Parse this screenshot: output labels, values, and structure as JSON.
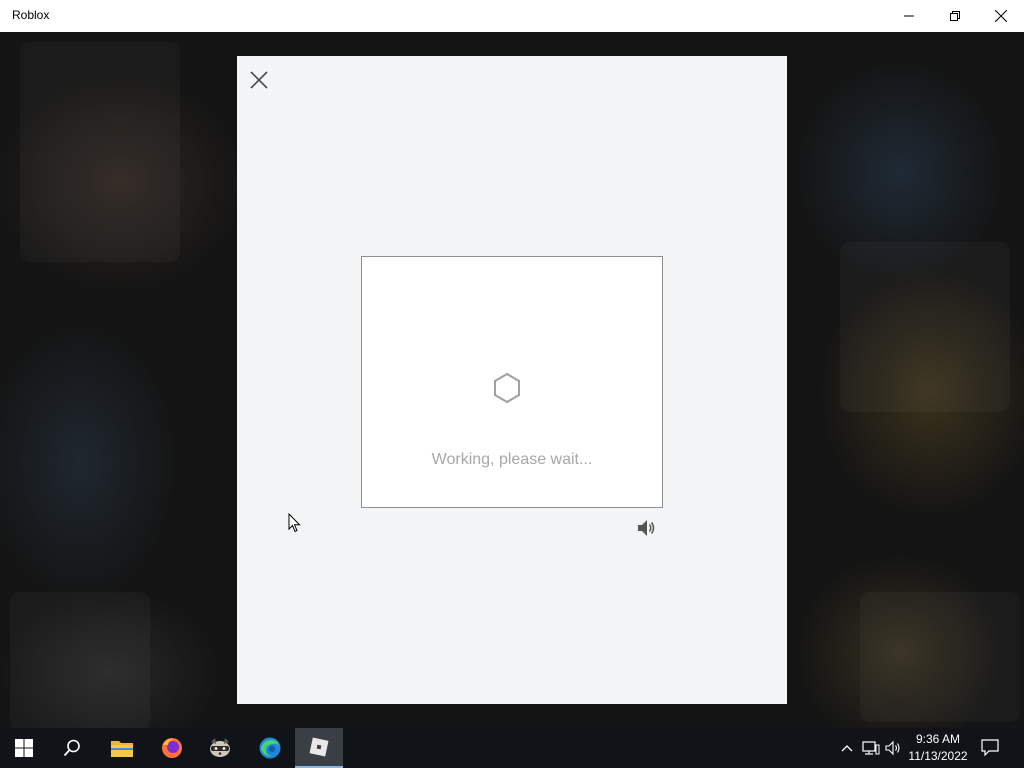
{
  "window": {
    "title": "Roblox",
    "controls": [
      "minimize",
      "maximize",
      "close"
    ]
  },
  "modal": {
    "close_label": "Close",
    "captcha": {
      "status_text": "Working, please wait...",
      "loading_icon": "hexagon-icon",
      "audio_icon": "speaker-icon"
    }
  },
  "taskbar": {
    "apps": [
      {
        "name": "start",
        "icon": "windows-icon"
      },
      {
        "name": "search",
        "icon": "search-icon"
      },
      {
        "name": "file-explorer",
        "icon": "folder-icon"
      },
      {
        "name": "firefox",
        "icon": "firefox-icon"
      },
      {
        "name": "raccoon-app",
        "icon": "raccoon-icon"
      },
      {
        "name": "edge",
        "icon": "edge-icon"
      },
      {
        "name": "roblox",
        "icon": "roblox-icon",
        "active": true
      }
    ],
    "tray": [
      "chevron-up-icon",
      "network-icon",
      "volume-icon"
    ],
    "time": "9:36 AM",
    "date": "11/13/2022"
  },
  "colors": {
    "modal_bg": "#f2f4f5",
    "taskbar_bg": "#101418",
    "status_text": "#a8a8a8"
  }
}
